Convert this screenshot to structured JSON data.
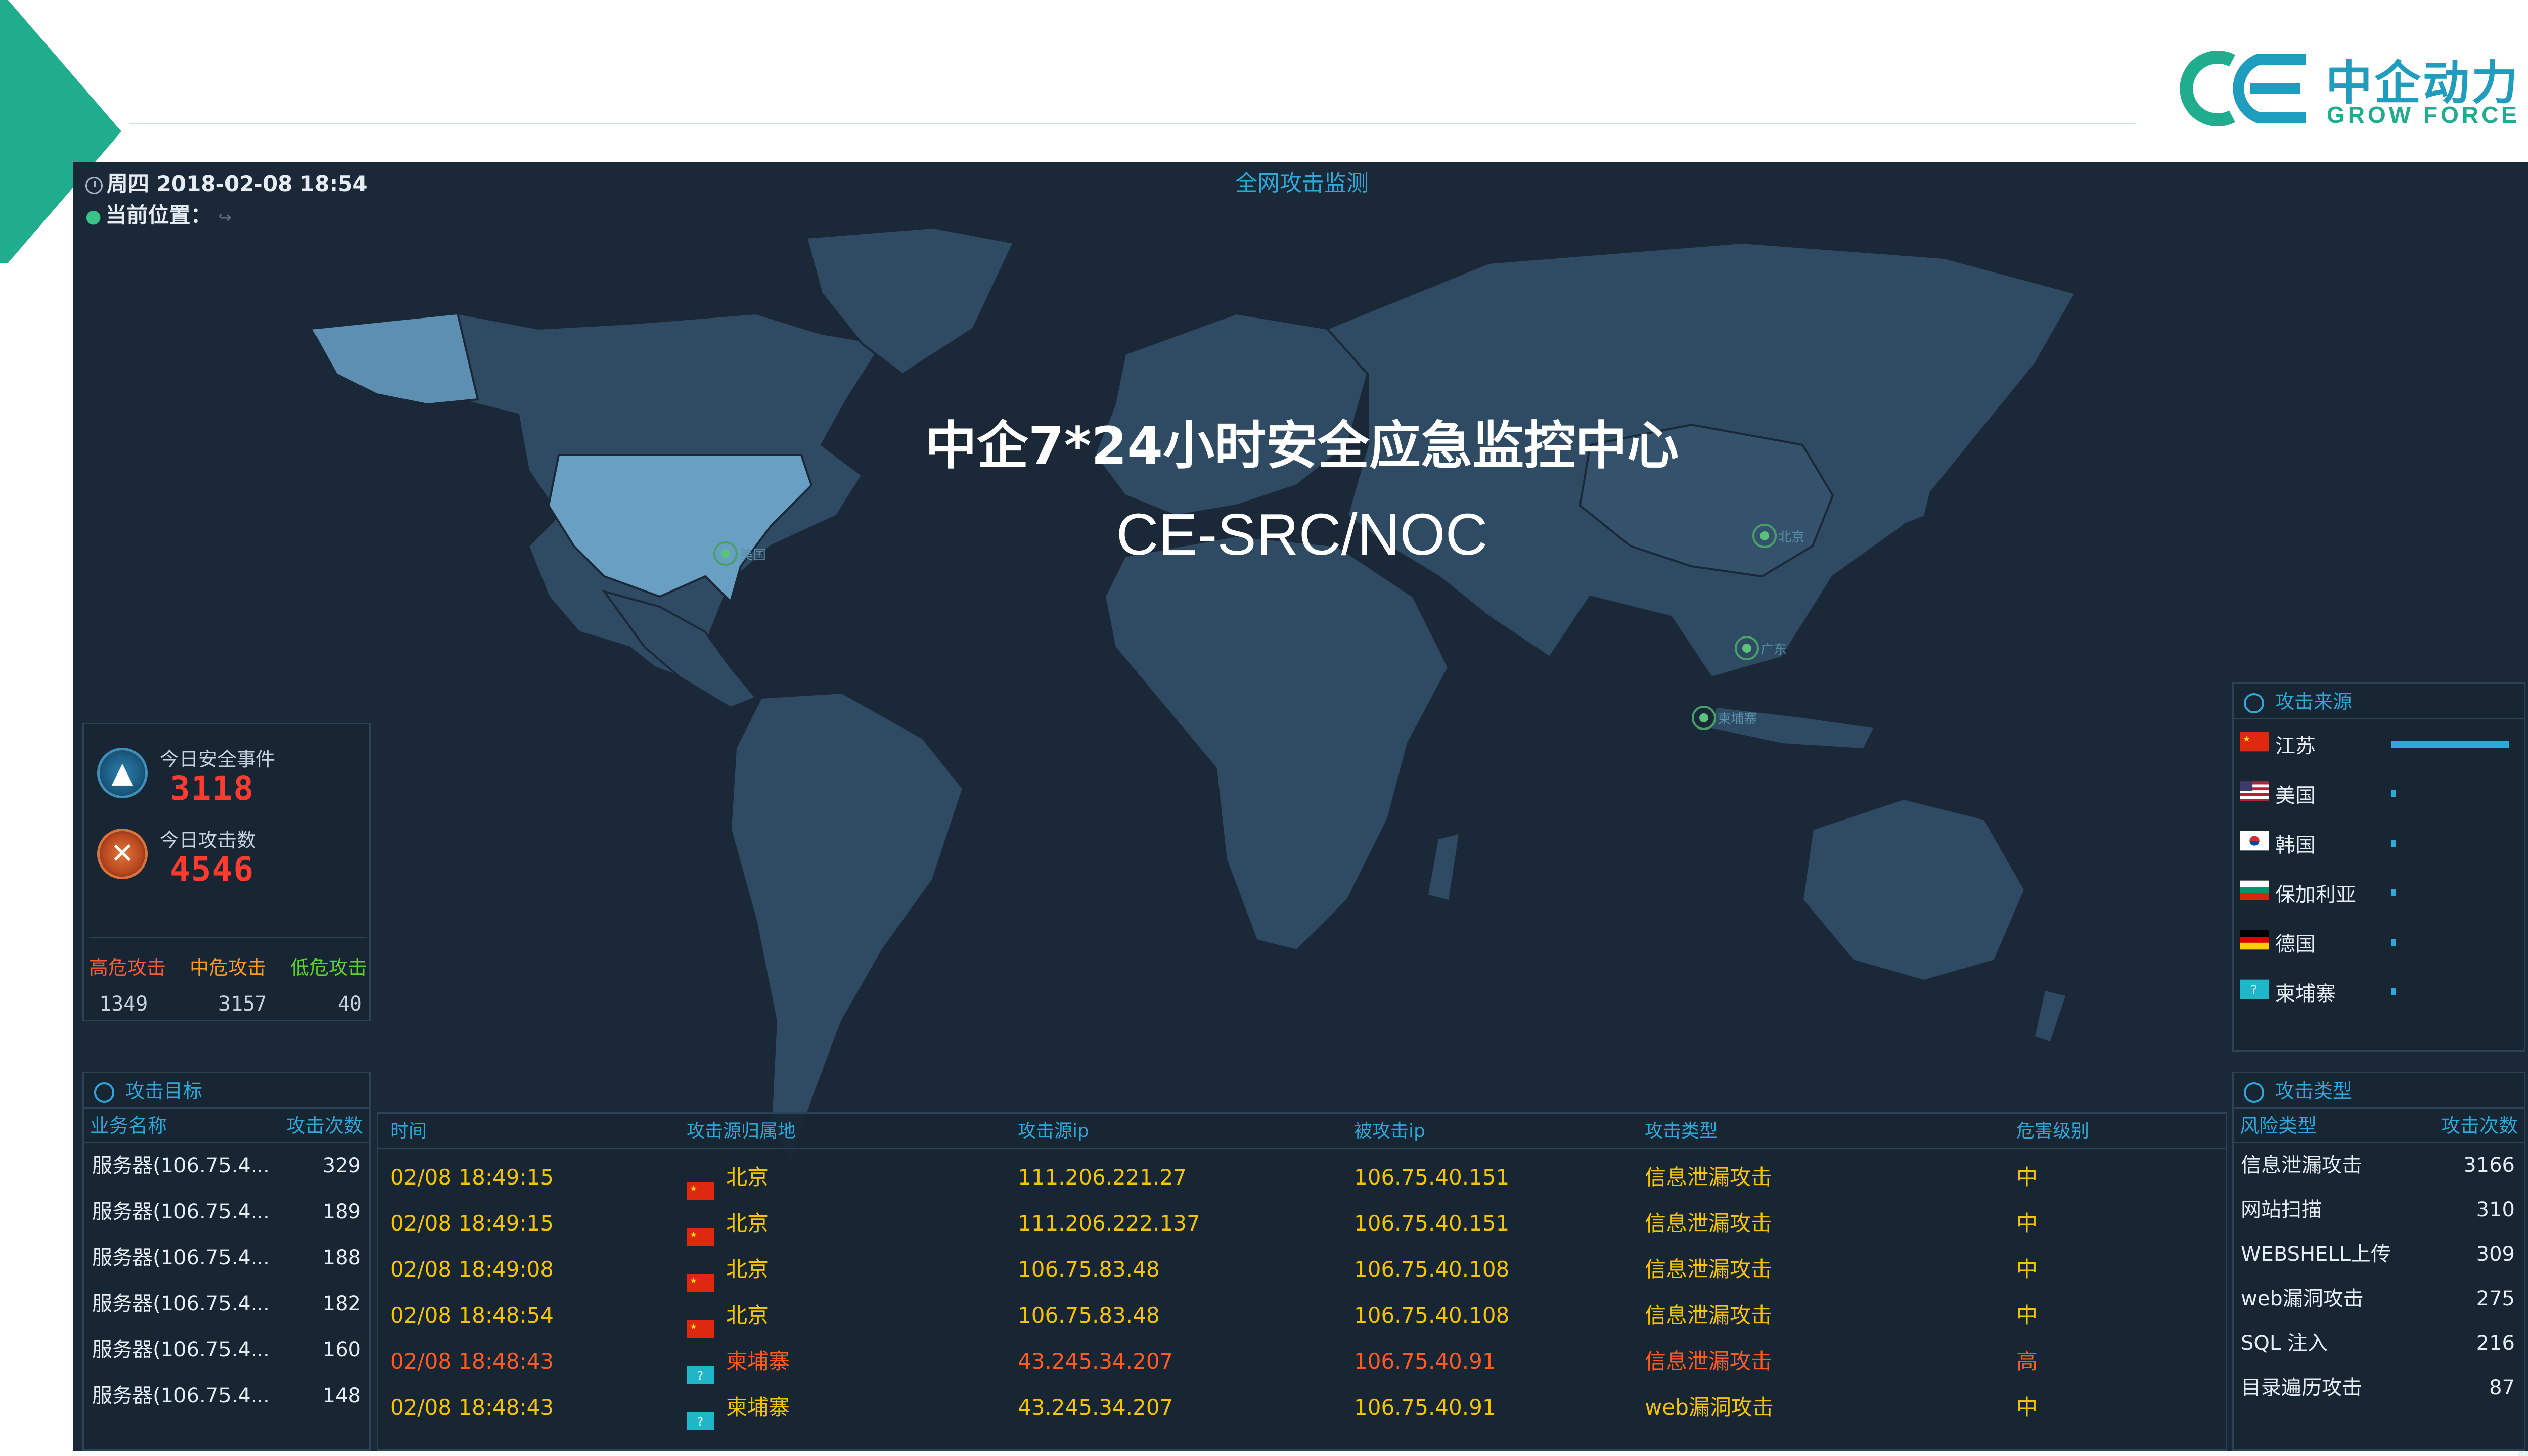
{
  "brand": {
    "name_cn": "中企动力",
    "name_en": "GROW FORCE",
    "accent": "#1fad8e",
    "blue": "#1f9dbf"
  },
  "dashboard": {
    "title": "全网攻击监测",
    "datetime": "周四 2018-02-08 18:54",
    "location_label": "当前位置：",
    "hero_line1": "中企7*24小时安全应急监控中心",
    "hero_line2": "CE-SRC/NOC"
  },
  "map_markers": [
    {
      "label": "美国"
    },
    {
      "label": "北京"
    },
    {
      "label": "广东"
    },
    {
      "label": "柬埔寨"
    }
  ],
  "stats": {
    "events_label": "今日安全事件",
    "events_value": "3118",
    "attacks_label": "今日攻击数",
    "attacks_value": "4546",
    "levels": [
      {
        "label": "高危攻击",
        "value": "1349",
        "color": "#ff5a36"
      },
      {
        "label": "中危攻击",
        "value": "3157",
        "color": "#ff9a1f"
      },
      {
        "label": "低危攻击",
        "value": "40",
        "color": "#5fd12f"
      }
    ]
  },
  "sources": {
    "title": "攻击来源",
    "items": [
      {
        "name": "江苏",
        "flag": "flag-cn-icon",
        "share": 0.97
      },
      {
        "name": "美国",
        "flag": "flag-us-icon",
        "share": 0.01
      },
      {
        "name": "韩国",
        "flag": "flag-kr-icon",
        "share": 0.01
      },
      {
        "name": "保加利亚",
        "flag": "flag-bg-icon",
        "share": 0.01
      },
      {
        "name": "德国",
        "flag": "flag-de-icon",
        "share": 0.01
      },
      {
        "name": "柬埔寨",
        "flag": "flag-unknown-icon",
        "share": 0.01
      }
    ]
  },
  "targets": {
    "title": "攻击目标",
    "col_name": "业务名称",
    "col_count": "攻击次数",
    "rows": [
      {
        "name": "服务器(106.75.4...",
        "count": "329"
      },
      {
        "name": "服务器(106.75.4...",
        "count": "189"
      },
      {
        "name": "服务器(106.75.4...",
        "count": "188"
      },
      {
        "name": "服务器(106.75.4...",
        "count": "182"
      },
      {
        "name": "服务器(106.75.4...",
        "count": "160"
      },
      {
        "name": "服务器(106.75.4...",
        "count": "148"
      }
    ]
  },
  "events": {
    "headers": {
      "time": "时间",
      "origin": "攻击源归属地",
      "src_ip": "攻击源ip",
      "dst_ip": "被攻击ip",
      "type": "攻击类型",
      "level": "危害级别"
    },
    "rows": [
      {
        "time": "02/08 18:49:15",
        "origin": "北京",
        "flag": "flag-cn-icon",
        "src_ip": "111.206.221.27",
        "dst_ip": "106.75.40.151",
        "type": "信息泄漏攻击",
        "level": "中",
        "severity": "medium"
      },
      {
        "time": "02/08 18:49:15",
        "origin": "北京",
        "flag": "flag-cn-icon",
        "src_ip": "111.206.222.137",
        "dst_ip": "106.75.40.151",
        "type": "信息泄漏攻击",
        "level": "中",
        "severity": "medium"
      },
      {
        "time": "02/08 18:49:08",
        "origin": "北京",
        "flag": "flag-cn-icon",
        "src_ip": "106.75.83.48",
        "dst_ip": "106.75.40.108",
        "type": "信息泄漏攻击",
        "level": "中",
        "severity": "medium"
      },
      {
        "time": "02/08 18:48:54",
        "origin": "北京",
        "flag": "flag-cn-icon",
        "src_ip": "106.75.83.48",
        "dst_ip": "106.75.40.108",
        "type": "信息泄漏攻击",
        "level": "中",
        "severity": "medium"
      },
      {
        "time": "02/08 18:48:43",
        "origin": "柬埔寨",
        "flag": "flag-unknown-icon",
        "src_ip": "43.245.34.207",
        "dst_ip": "106.75.40.91",
        "type": "信息泄漏攻击",
        "level": "高",
        "severity": "high"
      },
      {
        "time": "02/08 18:48:43",
        "origin": "柬埔寨",
        "flag": "flag-unknown-icon",
        "src_ip": "43.245.34.207",
        "dst_ip": "106.75.40.91",
        "type": "web漏洞攻击",
        "level": "中",
        "severity": "medium"
      }
    ],
    "colors": {
      "medium": "#f5c400",
      "high": "#ff5a1f"
    }
  },
  "types": {
    "title": "攻击类型",
    "col_name": "风险类型",
    "col_count": "攻击次数",
    "rows": [
      {
        "name": "信息泄漏攻击",
        "count": "3166"
      },
      {
        "name": "网站扫描",
        "count": "310"
      },
      {
        "name": "WEBSHELL上传",
        "count": "309"
      },
      {
        "name": "web漏洞攻击",
        "count": "275"
      },
      {
        "name": "SQL 注入",
        "count": "216"
      },
      {
        "name": "目录遍历攻击",
        "count": "87"
      }
    ]
  }
}
